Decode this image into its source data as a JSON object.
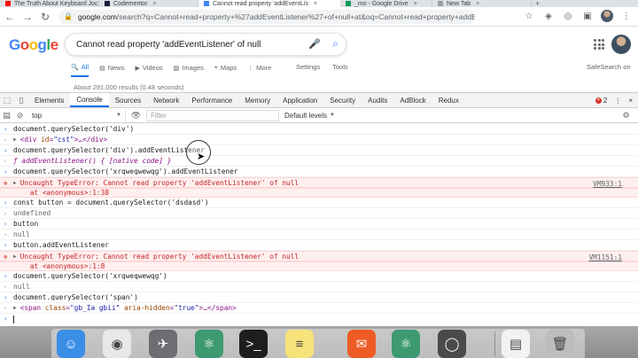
{
  "browser": {
    "tabs": [
      {
        "title": "The Truth About Keyboard Joch",
        "favicon_color": "#ff0000",
        "active": false
      },
      {
        "title": "Codementor",
        "favicon_color": "#1c1c3c",
        "active": false
      },
      {
        "title": "Cannot read property 'addEventLis",
        "favicon_color": "#4285f4",
        "active": true
      },
      {
        "title": "_mo - Google Drive",
        "favicon_color": "#0f9d58",
        "active": false
      },
      {
        "title": "New Tab",
        "favicon_color": "#9aa0a6",
        "active": false
      }
    ],
    "new_tab_symbol": "+",
    "url_host": "google.com",
    "url_path": "/search?q=Cannot+read+property+%27addEventListener%27+of+null+at&oq=Cannot+read+property+addEventListe..."
  },
  "google": {
    "logo": [
      {
        "ch": "G",
        "color": "#4285f4"
      },
      {
        "ch": "o",
        "color": "#ea4335"
      },
      {
        "ch": "o",
        "color": "#fbbc05"
      },
      {
        "ch": "g",
        "color": "#4285f4"
      },
      {
        "ch": "l",
        "color": "#34a853"
      },
      {
        "ch": "e",
        "color": "#ea4335"
      }
    ],
    "query": "Cannot read property 'addEventListener' of null",
    "tabs": [
      {
        "label": "All",
        "icon": "🔍",
        "active": true
      },
      {
        "label": "News",
        "icon": "▤",
        "active": false
      },
      {
        "label": "Videos",
        "icon": "▶",
        "active": false
      },
      {
        "label": "Images",
        "icon": "▨",
        "active": false
      },
      {
        "label": "Maps",
        "icon": "⌖",
        "active": false
      },
      {
        "label": "More",
        "icon": "⋮",
        "active": false
      }
    ],
    "settings_label": "Settings",
    "tools_label": "Tools",
    "safesearch_label": "SafeSearch on",
    "results_count": "About 291,000 results (0.48 seconds)"
  },
  "devtools": {
    "tabs": [
      "Elements",
      "Console",
      "Sources",
      "Network",
      "Performance",
      "Memory",
      "Application",
      "Security",
      "Audits",
      "AdBlock",
      "Redux"
    ],
    "active_tab": "Console",
    "error_count": "2",
    "context": "top",
    "filter_placeholder": "Filter",
    "levels_label": "Default levels"
  },
  "console": {
    "lines": [
      {
        "kind": "input",
        "prefix": "›",
        "text": "document.querySelector('div')"
      },
      {
        "kind": "result-el",
        "prefix": "‹",
        "tri": "▶",
        "tag_open": "<div ",
        "attr": "id",
        "eq": "=",
        "val": "\"cst\"",
        "rest": ">…</div>"
      },
      {
        "kind": "input",
        "prefix": "›",
        "text": "document.querySelector('div').addEventListener"
      },
      {
        "kind": "italic",
        "prefix": "‹",
        "text": "ƒ addEventListener() { [native code] }"
      },
      {
        "kind": "input",
        "prefix": "›",
        "text": "document.querySelector('xrqweqwewqg').addEventListener"
      },
      {
        "kind": "error",
        "prefix": "⊗",
        "tri": "▶",
        "text": "Uncaught TypeError: Cannot read property 'addEventListener' of null",
        "src": "VM933:1"
      },
      {
        "kind": "error-sub",
        "prefix": "",
        "text": "    at <anonymous>:1:38"
      },
      {
        "kind": "input",
        "prefix": "›",
        "text": "const button = document.querySelector('dsdasd')"
      },
      {
        "kind": "result",
        "prefix": "‹",
        "text": "undefined"
      },
      {
        "kind": "input",
        "prefix": "›",
        "text": "button"
      },
      {
        "kind": "result",
        "prefix": "‹",
        "text": "null"
      },
      {
        "kind": "input",
        "prefix": "›",
        "text": "button.addEventListener"
      },
      {
        "kind": "error",
        "prefix": "⊗",
        "tri": "▶",
        "text": "Uncaught TypeError: Cannot read property 'addEventListener' of null",
        "src": "VM1151:1"
      },
      {
        "kind": "error-sub",
        "prefix": "",
        "text": "    at <anonymous>:1:8"
      },
      {
        "kind": "input",
        "prefix": "›",
        "text": "document.querySelector('xrqweqwewqg')"
      },
      {
        "kind": "result",
        "prefix": "‹",
        "text": "null"
      },
      {
        "kind": "input",
        "prefix": "›",
        "text": "document.querySelector('span')"
      },
      {
        "kind": "result-el",
        "prefix": "‹",
        "tri": "▶",
        "tag_open": "<span ",
        "attr": "class",
        "eq": "=",
        "val": "\"gb_Ia gbii\"",
        "attr2": " aria-hidden",
        "eq2": "=",
        "val2": "\"true\"",
        "rest": ">…</span>"
      }
    ],
    "prompt_symbol": "›"
  },
  "dock": {
    "apps": [
      {
        "name": "finder-app",
        "bg": "#3a8ee6",
        "glyph": "☺"
      },
      {
        "name": "chrome-app",
        "bg": "#e8e8e8",
        "glyph": "◉"
      },
      {
        "name": "launchpad-app",
        "bg": "#6d6d72",
        "glyph": "✈"
      },
      {
        "name": "atom-app",
        "bg": "#3d9970",
        "glyph": "⚛"
      },
      {
        "name": "terminal-app",
        "bg": "#1e1e1e",
        "glyph": ">_"
      },
      {
        "name": "notes-app",
        "bg": "#f7e27a",
        "glyph": "≡"
      },
      {
        "name": "postman-app",
        "bg": "#ef5b25",
        "glyph": "✉"
      },
      {
        "name": "atom-beta-app",
        "bg": "#3d9970",
        "glyph": "⚛"
      },
      {
        "name": "quicktime-app",
        "bg": "#4a4a4a",
        "glyph": "◯"
      },
      {
        "name": "preview-app",
        "bg": "#f2f2f2",
        "glyph": "▤"
      },
      {
        "name": "trash-app",
        "bg": "#bdbdbd",
        "glyph": "🗑"
      }
    ]
  }
}
